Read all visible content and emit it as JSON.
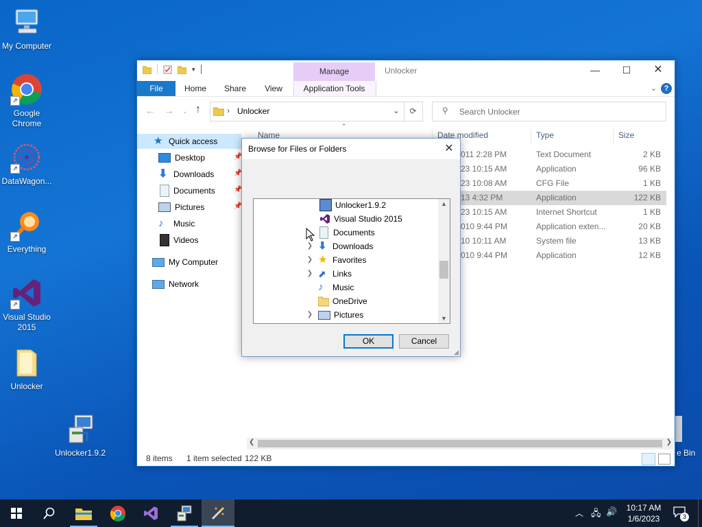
{
  "desktop": {
    "icons": [
      {
        "label": "My Computer"
      },
      {
        "label": "Google Chrome"
      },
      {
        "label": "DataWagon..."
      },
      {
        "label": "Everything"
      },
      {
        "label": "Visual Studio 2015"
      },
      {
        "label": "Unlocker"
      },
      {
        "label": "Unlocker1.9.2"
      },
      {
        "label": "e Bin"
      }
    ]
  },
  "explorer": {
    "title": "Unlocker",
    "manage_tab": "Manage",
    "ribbon_tabs": [
      "File",
      "Home",
      "Share",
      "View",
      "Application Tools"
    ],
    "address": {
      "crumb_sep": "›",
      "folder": "Unlocker"
    },
    "search_placeholder": "Search Unlocker",
    "nav": [
      {
        "label": "Quick access"
      },
      {
        "label": "Desktop"
      },
      {
        "label": "Downloads"
      },
      {
        "label": "Documents"
      },
      {
        "label": "Pictures"
      },
      {
        "label": "Music"
      },
      {
        "label": "Videos"
      },
      {
        "label": "My Computer"
      },
      {
        "label": "Network"
      }
    ],
    "columns": [
      "Name",
      "Date modified",
      "Type",
      "Size"
    ],
    "rows": [
      {
        "date": "011 2:28 PM",
        "type": "Text Document",
        "size": "2 KB"
      },
      {
        "date": "23 10:15 AM",
        "type": "Application",
        "size": "96 KB"
      },
      {
        "date": "23 10:08 AM",
        "type": "CFG File",
        "size": "1 KB"
      },
      {
        "date": "13 4:32 PM",
        "type": "Application",
        "size": "122 KB"
      },
      {
        "date": "23 10:15 AM",
        "type": "Internet Shortcut",
        "size": "1 KB"
      },
      {
        "date": "010 9:44 PM",
        "type": "Application exten...",
        "size": "20 KB"
      },
      {
        "date": "10 10:11 AM",
        "type": "System file",
        "size": "13 KB"
      },
      {
        "date": "010 9:44 PM",
        "type": "Application",
        "size": "12 KB"
      }
    ],
    "status": {
      "items": "8 items",
      "selected": "1 item selected",
      "size": "122 KB"
    }
  },
  "dialog": {
    "title": "Browse for Files or Folders",
    "tree": [
      {
        "label": "Unlocker1.9.2",
        "expandable": false
      },
      {
        "label": "Visual Studio 2015",
        "expandable": false
      },
      {
        "label": "Documents",
        "expandable": false
      },
      {
        "label": "Downloads",
        "expandable": true
      },
      {
        "label": "Favorites",
        "expandable": true
      },
      {
        "label": "Links",
        "expandable": true
      },
      {
        "label": "Music",
        "expandable": false
      },
      {
        "label": "OneDrive",
        "expandable": false
      },
      {
        "label": "Pictures",
        "expandable": true
      }
    ],
    "ok_label": "OK",
    "cancel_label": "Cancel"
  },
  "taskbar": {
    "time": "10:17 AM",
    "date": "1/6/2023",
    "notifications": "3"
  }
}
